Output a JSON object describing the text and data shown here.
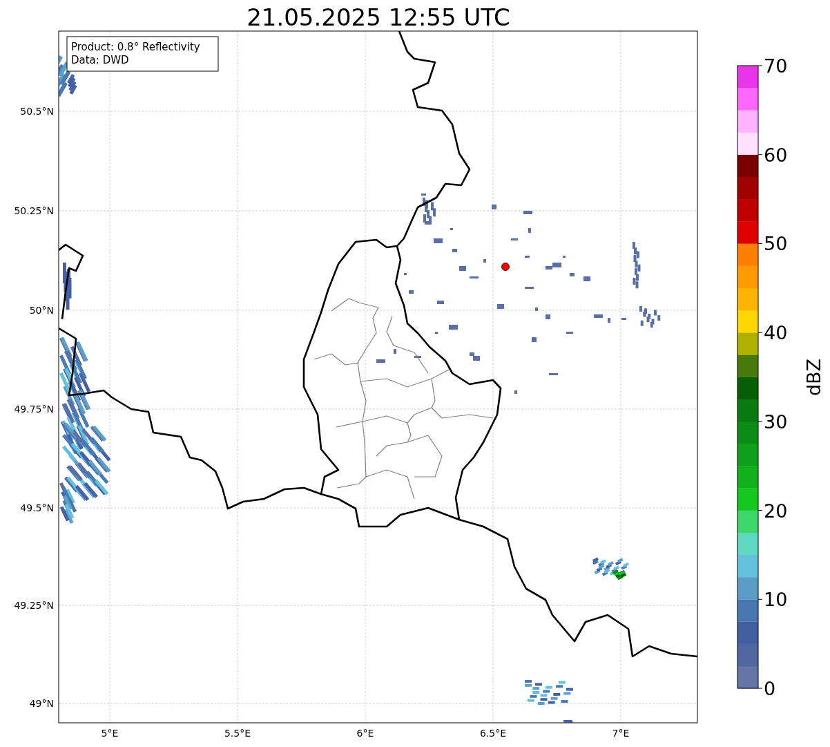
{
  "title": "21.05.2025 12:55 UTC",
  "legend": {
    "lines": [
      "Product: 0.8° Reflectivity",
      "Data: DWD"
    ]
  },
  "map": {
    "x_ticks": [
      "5°E",
      "5.5°E",
      "6°E",
      "6.5°E",
      "7°E"
    ],
    "y_ticks": [
      "50.5°N",
      "50.25°N",
      "50°N",
      "49.75°N",
      "49.5°N",
      "49.25°N",
      "49°N"
    ]
  },
  "colorbar": {
    "label": "dBZ",
    "ticks": [
      "70",
      "60",
      "50",
      "40",
      "30",
      "20",
      "10",
      "0"
    ],
    "bins": [
      {
        "color": "#6475a6"
      },
      {
        "color": "#4f669e"
      },
      {
        "color": "#425fa2"
      },
      {
        "color": "#4877b0"
      },
      {
        "color": "#5a9cc6"
      },
      {
        "color": "#63c1dc"
      },
      {
        "color": "#5fd8c4"
      },
      {
        "color": "#3dd66b"
      },
      {
        "color": "#12c81c"
      },
      {
        "color": "#10b01a"
      },
      {
        "color": "#0ea018"
      },
      {
        "color": "#0b8c14"
      },
      {
        "color": "#087a10"
      },
      {
        "color": "#056005"
      },
      {
        "color": "#477a0a"
      },
      {
        "color": "#b0b000"
      },
      {
        "color": "#ffd700"
      },
      {
        "color": "#ffb400"
      },
      {
        "color": "#ff9a00"
      },
      {
        "color": "#ff8000"
      },
      {
        "color": "#e00000"
      },
      {
        "color": "#c00000"
      },
      {
        "color": "#a00000"
      },
      {
        "color": "#7a0000"
      },
      {
        "color": "#ffe0ff"
      },
      {
        "color": "#ffb3ff"
      },
      {
        "color": "#ff66ff"
      },
      {
        "color": "#e935ea"
      }
    ]
  }
}
